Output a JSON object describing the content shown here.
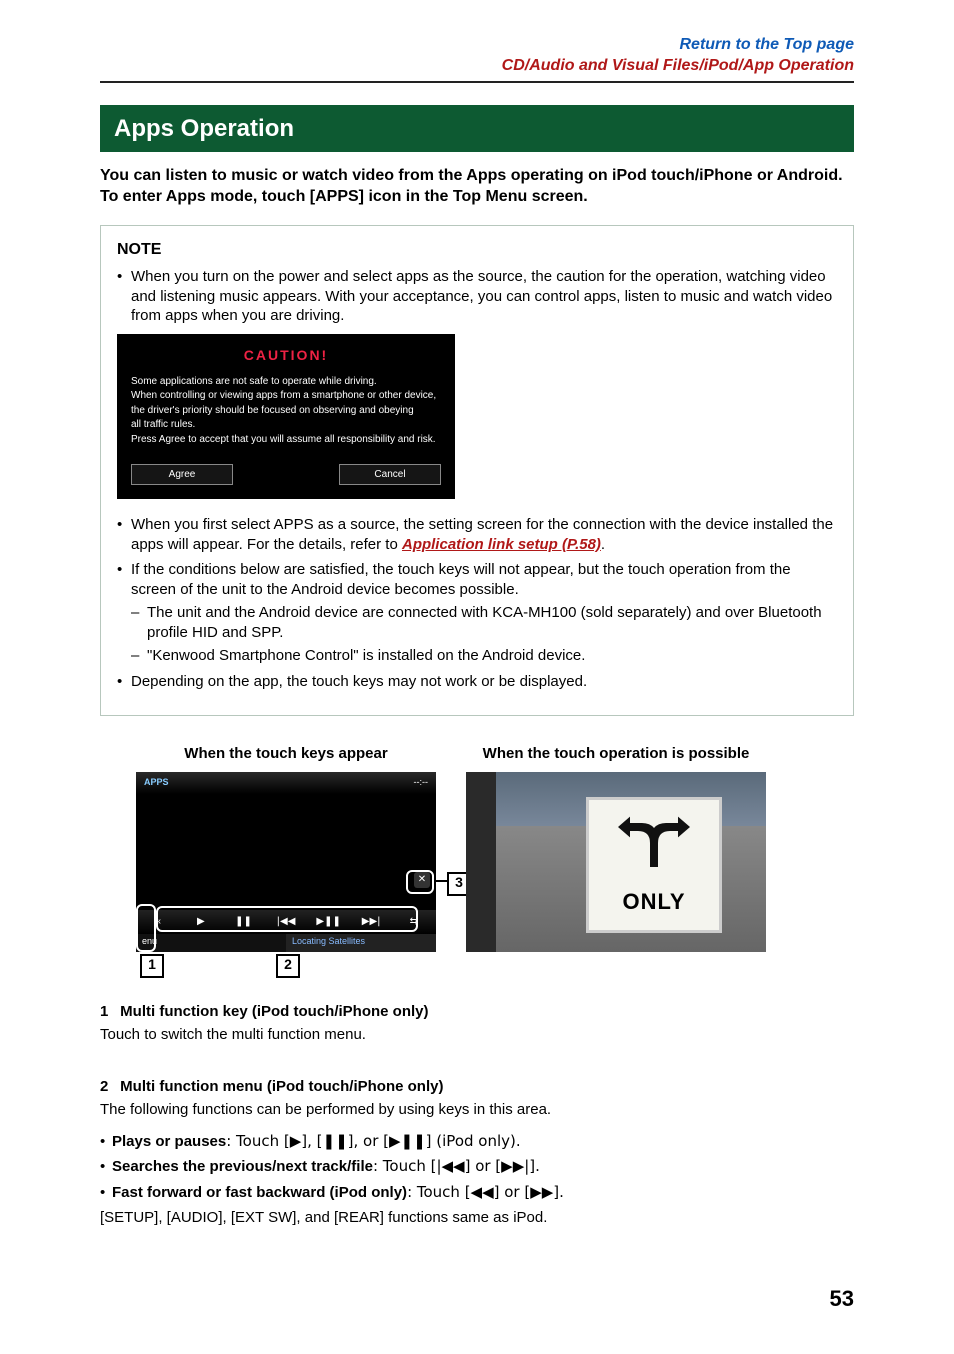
{
  "header": {
    "top_link": "Return to the Top page",
    "section_link": "CD/Audio and Visual Files/iPod/App Operation"
  },
  "title_bar": "Apps Operation",
  "intro": "You can listen to music or watch video from the Apps operating on iPod touch/iPhone or Android. To enter Apps mode, touch [APPS] icon in the Top Menu screen.",
  "note": {
    "heading": "NOTE",
    "item1": "When you turn on the power and select apps as the source, the caution for the operation, watching video and listening music appears. With your acceptance, you can control apps, listen to music and watch video from apps when you are driving.",
    "caution": {
      "title": "CAUTION!",
      "l1": "Some applications are not safe to operate while driving.",
      "l2": "When controlling or viewing apps from a smartphone or other device,",
      "l3": "the driver's priority should be focused on observing and obeying",
      "l4": "all traffic rules.",
      "l5": "Press Agree to accept that you will assume all responsibility and risk.",
      "agree": "Agree",
      "cancel": "Cancel"
    },
    "item2a": "When you first select APPS as a source, the setting screen for the connection with the device installed the apps will appear. For the details, refer to ",
    "item2link": "Application link setup (P.58)",
    "item2b": ".",
    "item3": "If the conditions below are satisfied, the touch keys will not appear, but the touch operation from the screen of the unit to the Android device becomes possible.",
    "item3s1": "The unit and the Android device are connected with KCA-MH100 (sold separately) and over Bluetooth profile HID and SPP.",
    "item3s2": "\"Kenwood Smartphone Control\" is installed on the Android device.",
    "item4": "Depending on the app, the touch keys may not work or be displayed."
  },
  "figs": {
    "left_caption": "When the touch keys appear",
    "right_caption": "When the touch operation is possible",
    "apps_label": "APPS",
    "menu": "enu",
    "locating": "Locating Satellites",
    "close_glyph": "✕",
    "sign_text": "ONLY",
    "co1": "1",
    "co2": "2",
    "co3": "3"
  },
  "numbered": {
    "h1": "Multi function key (iPod touch/iPhone only)",
    "d1": "Touch to switch the multi function menu.",
    "h2": "Multi function menu (iPod touch/iPhone only)",
    "d2": "The following functions can be performed by using keys in this area.",
    "f1a": "Plays or pauses",
    "f1b": ": Touch [▶], [❚❚], or [▶❚❚] (iPod only).",
    "f2a": "Searches the previous/next track/file",
    "f2b": ": Touch [|◀◀] or [▶▶|].",
    "f3a": "Fast forward or fast backward (iPod only)",
    "f3b": ": Touch [◀◀] or [▶▶].",
    "f4": "[SETUP], [AUDIO], [EXT SW], and [REAR] functions same as iPod."
  },
  "page_number": "53"
}
